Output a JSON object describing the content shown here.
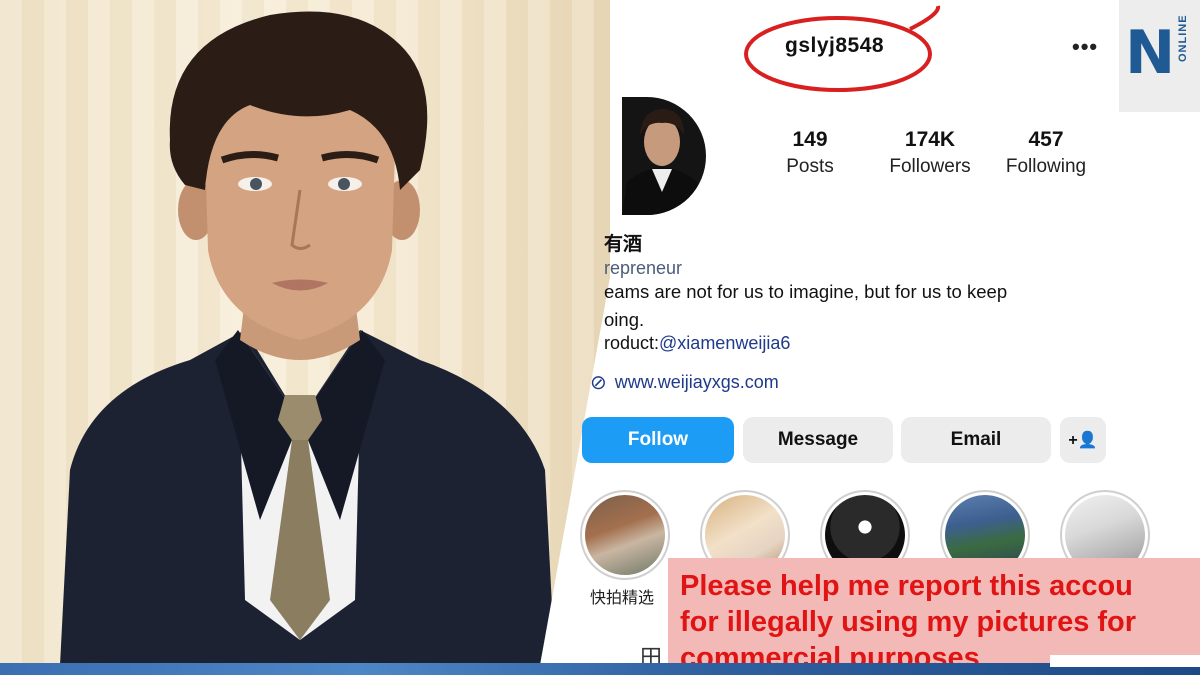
{
  "profile": {
    "username": "gslyj8548",
    "more_icon": "more-horizontal-icon",
    "stats": {
      "posts_count": "149",
      "posts_label": "Posts",
      "followers_count": "174K",
      "followers_label": "Followers",
      "following_count": "457",
      "following_label": "Following"
    },
    "bio": {
      "name": "有酒",
      "category": "repreneur",
      "line1": "eams are not for us to imagine, but for us to keep",
      "line2": "oing.",
      "product_prefix": "roduct:",
      "product_mention": "@xiamenweijia6",
      "link": "www.weijiayxgs.com"
    },
    "buttons": {
      "follow": "Follow",
      "message": "Message",
      "email": "Email",
      "add_user_icon": "+👤"
    },
    "highlight_label": "快拍精选",
    "grid_icon": "田"
  },
  "caption": {
    "line1": "Please help me report this  accou",
    "line2": "for illegally using my pictures for",
    "line3": "commercial purposes"
  },
  "logo": {
    "letter": "N",
    "text": "ONLINE"
  },
  "colors": {
    "follow_button": "#1c9cf4",
    "caption_text": "#e01414",
    "caption_bg": "#f3b9b6",
    "circle_mark": "#d92020",
    "logo_blue": "#1f5a94"
  }
}
